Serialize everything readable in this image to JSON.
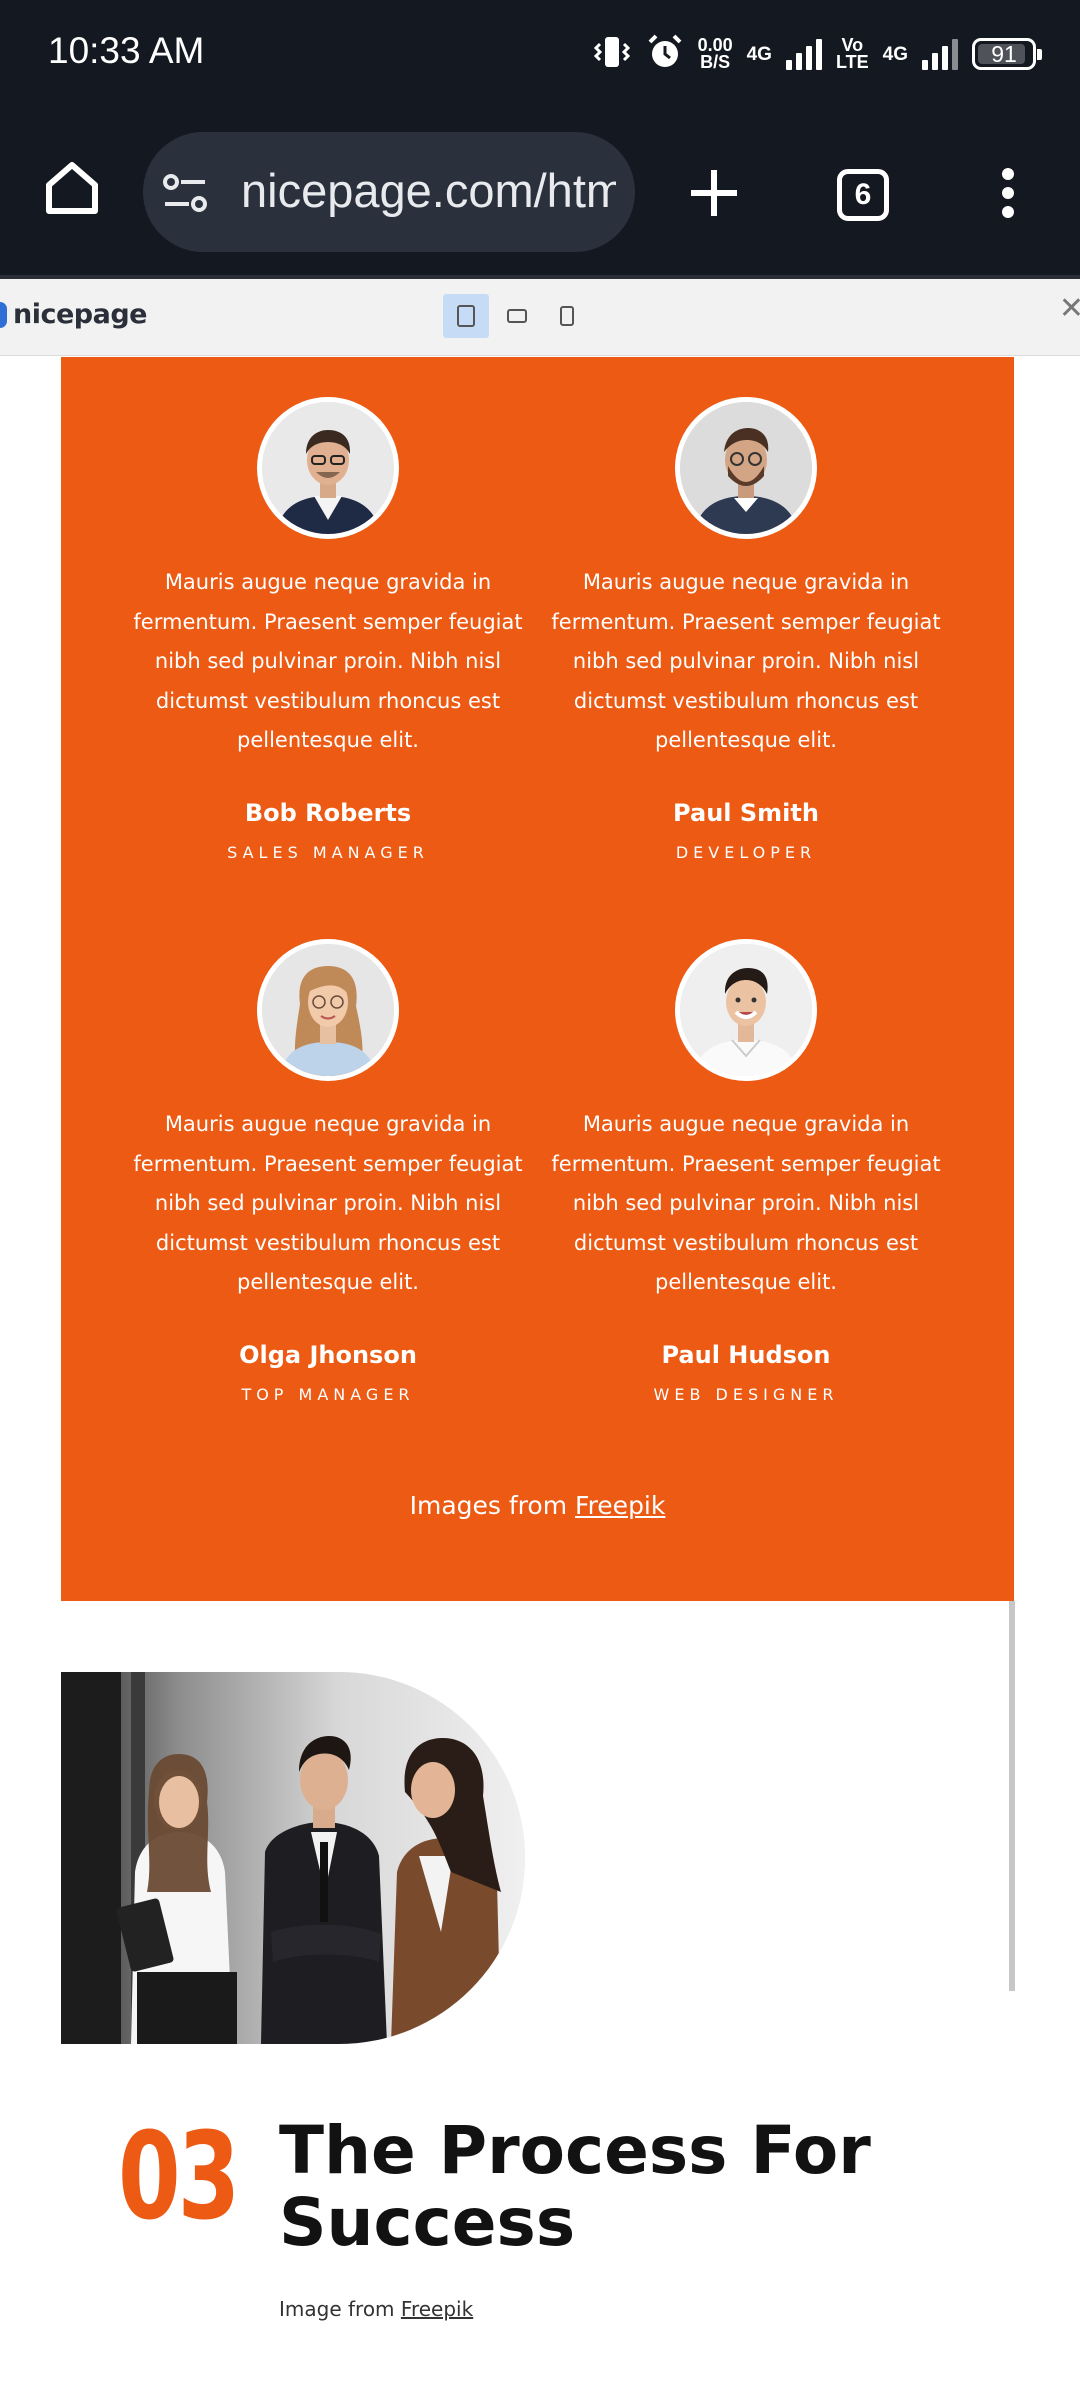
{
  "status_bar": {
    "time": "10:33 AM",
    "net_speed_value": "0.00",
    "net_speed_unit": "B/S",
    "sim1_label": "4G",
    "volte_line1": "Vo",
    "volte_line2": "LTE",
    "sim2_label": "4G",
    "battery_percent": "91",
    "icons": [
      "vibrate-icon",
      "alarm-icon",
      "signal-icon",
      "battery-icon"
    ]
  },
  "browser": {
    "url": "nicepage.com/html",
    "tab_count": "6",
    "icons": [
      "home-icon",
      "site-settings-icon",
      "new-tab-icon",
      "tab-switcher-icon",
      "more-menu-icon"
    ]
  },
  "preview_bar": {
    "brand": "nicepage",
    "devices": [
      "desktop",
      "tablet-landscape",
      "phone"
    ],
    "active_device": "desktop"
  },
  "team": {
    "members": [
      {
        "quote": "Mauris augue neque gravida in fermentum. Praesent semper feugiat nibh sed pulvinar proin. Nibh nisl dictumst vestibulum rhoncus est pellentesque elit.",
        "name": "Bob Roberts",
        "role": "SALES MANAGER"
      },
      {
        "quote": "Mauris augue neque gravida in fermentum. Praesent semper feugiat nibh sed pulvinar proin. Nibh nisl dictumst vestibulum rhoncus est pellentesque elit.",
        "name": "Paul Smith",
        "role": "DEVELOPER"
      },
      {
        "quote": "Mauris augue neque gravida in fermentum. Praesent semper feugiat nibh sed pulvinar proin. Nibh nisl dictumst vestibulum rhoncus est pellentesque elit.",
        "name": "Olga Jhonson",
        "role": "TOP MANAGER"
      },
      {
        "quote": "Mauris augue neque gravida in fermentum. Praesent semper feugiat nibh sed pulvinar proin. Nibh nisl dictumst vestibulum rhoncus est pellentesque elit.",
        "name": "Paul Hudson",
        "role": "WEB DESIGNER"
      }
    ],
    "credit_prefix": "Images from ",
    "credit_link": "Freepik"
  },
  "process": {
    "number": "03",
    "title": "The Process For Success",
    "credit_prefix": "Image from ",
    "credit_link": "Freepik"
  },
  "colors": {
    "accent": "#ec5a14",
    "chrome_dark": "#141821",
    "url_pill": "#2b313c"
  }
}
